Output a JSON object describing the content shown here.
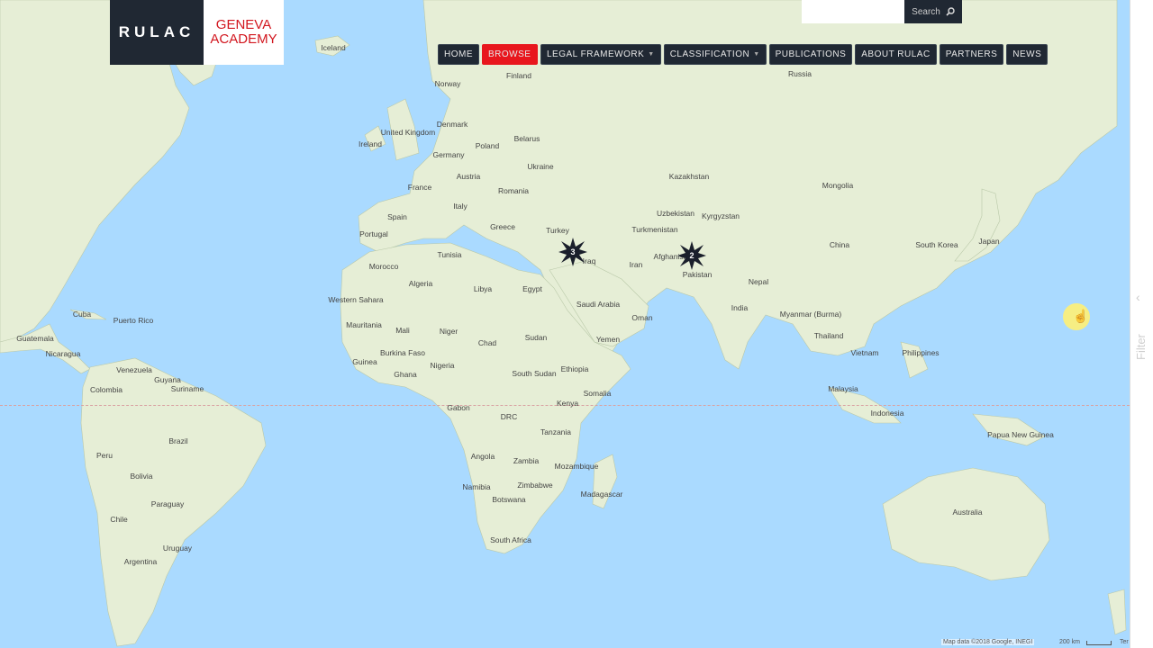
{
  "brand": {
    "name": "RULAC",
    "partner_line1": "GENEVA",
    "partner_line2": "ACADEMY"
  },
  "search": {
    "placeholder": "",
    "button_label": "Search"
  },
  "nav": [
    {
      "label": "HOME",
      "active": false,
      "dropdown": false
    },
    {
      "label": "BROWSE",
      "active": true,
      "dropdown": false
    },
    {
      "label": "LEGAL FRAMEWORK",
      "active": false,
      "dropdown": true
    },
    {
      "label": "CLASSIFICATION",
      "active": false,
      "dropdown": true
    },
    {
      "label": "PUBLICATIONS",
      "active": false,
      "dropdown": false
    },
    {
      "label": "ABOUT RULAC",
      "active": false,
      "dropdown": false
    },
    {
      "label": "PARTNERS",
      "active": false,
      "dropdown": false
    },
    {
      "label": "NEWS",
      "active": false,
      "dropdown": false
    }
  ],
  "filter_panel": {
    "label": "Filter"
  },
  "map": {
    "markers": [
      {
        "count": "3",
        "near": "Iraq"
      },
      {
        "count": "2",
        "near": "Pakistan"
      }
    ],
    "labels": [
      "Iceland",
      "Norway",
      "Finland",
      "Russia",
      "United Kingdom",
      "Denmark",
      "Ireland",
      "Belarus",
      "Poland",
      "Germany",
      "Ukraine",
      "Kazakhstan",
      "France",
      "Austria",
      "Romania",
      "Mongolia",
      "Spain",
      "Italy",
      "Uzbekistan",
      "Kyrgyzstan",
      "Portugal",
      "Greece",
      "Turkey",
      "Turkmenistan",
      "China",
      "South Korea",
      "Japan",
      "Tunisia",
      "Iraq",
      "Iran",
      "Afghanistan",
      "Pakistan",
      "Morocco",
      "Algeria",
      "Libya",
      "Egypt",
      "Saudi Arabia",
      "Nepal",
      "Western Sahara",
      "Oman",
      "India",
      "Myanmar (Burma)",
      "Mauritania",
      "Mali",
      "Niger",
      "Chad",
      "Sudan",
      "Yemen",
      "Thailand",
      "Vietnam",
      "Philippines",
      "Burkina Faso",
      "Guinea",
      "Ghana",
      "Nigeria",
      "South Sudan",
      "Ethiopia",
      "Malaysia",
      "Somalia",
      "Kenya",
      "Gabon",
      "DRC",
      "Indonesia",
      "Tanzania",
      "Papua New Guinea",
      "Angola",
      "Zambia",
      "Mozambique",
      "Namibia",
      "Zimbabwe",
      "Madagascar",
      "Botswana",
      "Australia",
      "South Africa",
      "Cuba",
      "Puerto Rico",
      "Guatemala",
      "Nicaragua",
      "Venezuela",
      "Guyana",
      "Colombia",
      "Suriname",
      "Peru",
      "Brazil",
      "Bolivia",
      "Paraguay",
      "Chile",
      "Uruguay",
      "Argentina"
    ]
  },
  "footer": {
    "attribution": "Map data ©2018 Google, INEGI",
    "scale": "200 km",
    "terms": "Ter"
  },
  "colors": {
    "water": "#aadaff",
    "land": "#e8efd9",
    "nav_bg": "#202833",
    "accent": "#e8161d",
    "marker": "#1a1f2b"
  }
}
